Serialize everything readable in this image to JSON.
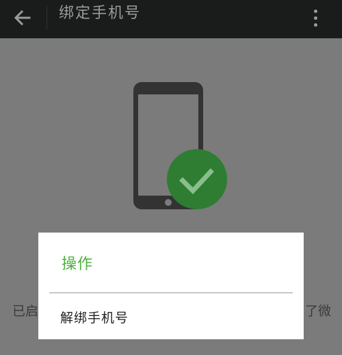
{
  "header": {
    "title": "绑定手机号",
    "back_icon": "arrow-left-icon",
    "more_icon": "more-vertical-icon"
  },
  "illustration": {
    "phone_icon": "smartphone-icon",
    "check_icon": "check-circle-icon",
    "check_color": "#2e7d32"
  },
  "background_status": {
    "left_text": "已启",
    "right_text": "了微"
  },
  "dialog": {
    "title": "操作",
    "title_color": "#4caf3c",
    "items": [
      {
        "label": "解绑手机号"
      }
    ]
  }
}
